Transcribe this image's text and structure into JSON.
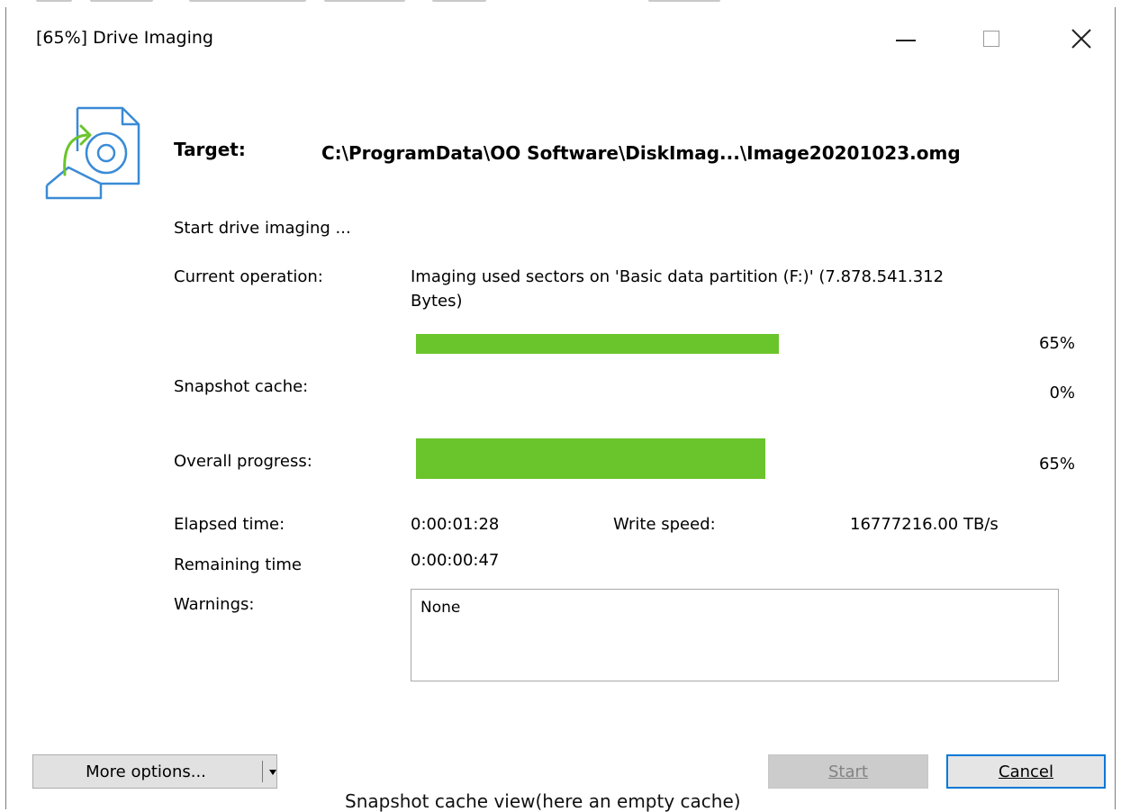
{
  "window": {
    "title": "[65%] Drive Imaging"
  },
  "target": {
    "label": "Target:",
    "path": "C:\\ProgramData\\OO Software\\DiskImag...\\Image20201023.omg"
  },
  "status_text": "Start drive imaging ...",
  "current_operation": {
    "label": "Current operation:",
    "line1": "Imaging used sectors on 'Basic data partition (F:)' (7.878.541.312",
    "line2": "Bytes)",
    "progress_percent": 65,
    "percent_text": "65%"
  },
  "snapshot_cache": {
    "label": "Snapshot cache:",
    "progress_percent": 0,
    "percent_text": "0%"
  },
  "overall_progress": {
    "label": "Overall progress:",
    "progress_percent": 65,
    "percent_text": "65%"
  },
  "times": {
    "elapsed_label": "Elapsed time:",
    "elapsed_value": "0:00:01:28",
    "write_speed_label": "Write speed:",
    "write_speed_value": "16777216.00 TB/s",
    "remaining_label": "Remaining time",
    "remaining_value": "0:00:00:47"
  },
  "warnings": {
    "label": "Warnings:",
    "value": "None"
  },
  "buttons": {
    "more_options": "More options...",
    "start": "Start",
    "cancel": "Cancel"
  },
  "caption": "Snapshot cache view(here an empty cache)",
  "colors": {
    "progress": "#6ac42b",
    "accent": "#0078d7"
  },
  "icons": [
    "disk-image-icon",
    "minimize-icon",
    "maximize-icon",
    "close-icon",
    "dropdown-arrow-icon"
  ]
}
